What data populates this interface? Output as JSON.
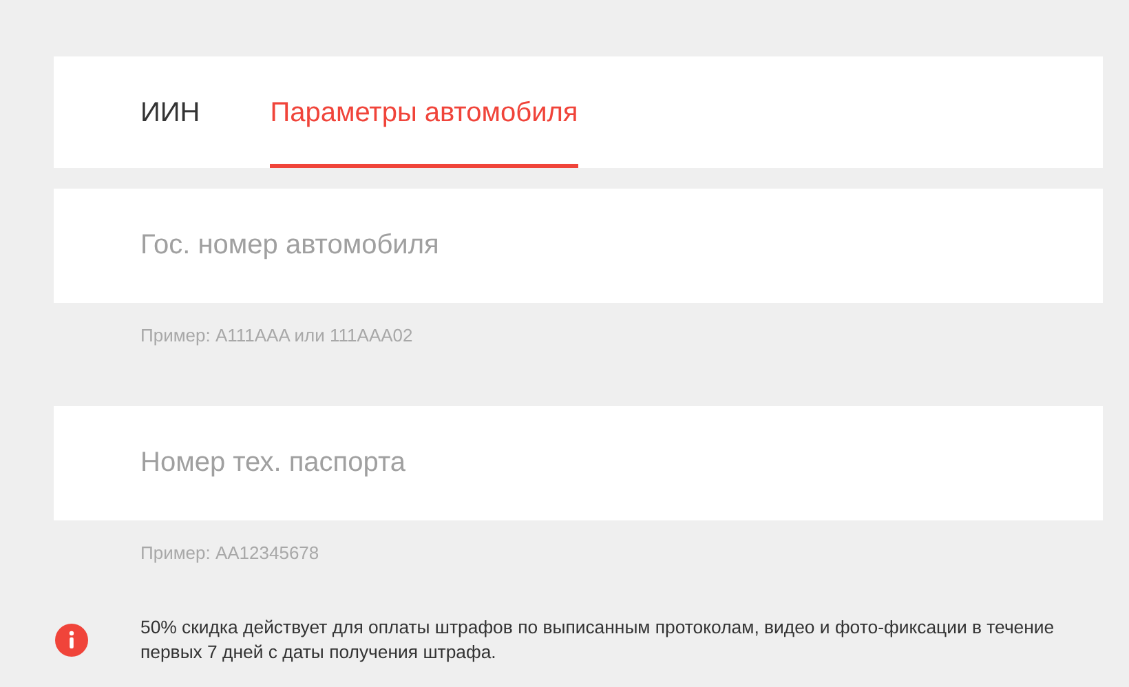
{
  "tabs": [
    {
      "label": "ИИН",
      "selected": false
    },
    {
      "label": "Параметры автомобиля",
      "selected": true
    }
  ],
  "fields": [
    {
      "placeholder": "Гос. номер автомобиля",
      "hint": "Пример: A111AAA или 111AAA02"
    },
    {
      "placeholder": "Номер тех. паспорта",
      "hint": "Пример: AA12345678"
    }
  ],
  "notice": {
    "text": "50% скидка действует для оплаты штрафов по выписанным протоколам, видео и фото-фиксации в течение первых 7 дней с даты получения штрафа."
  }
}
